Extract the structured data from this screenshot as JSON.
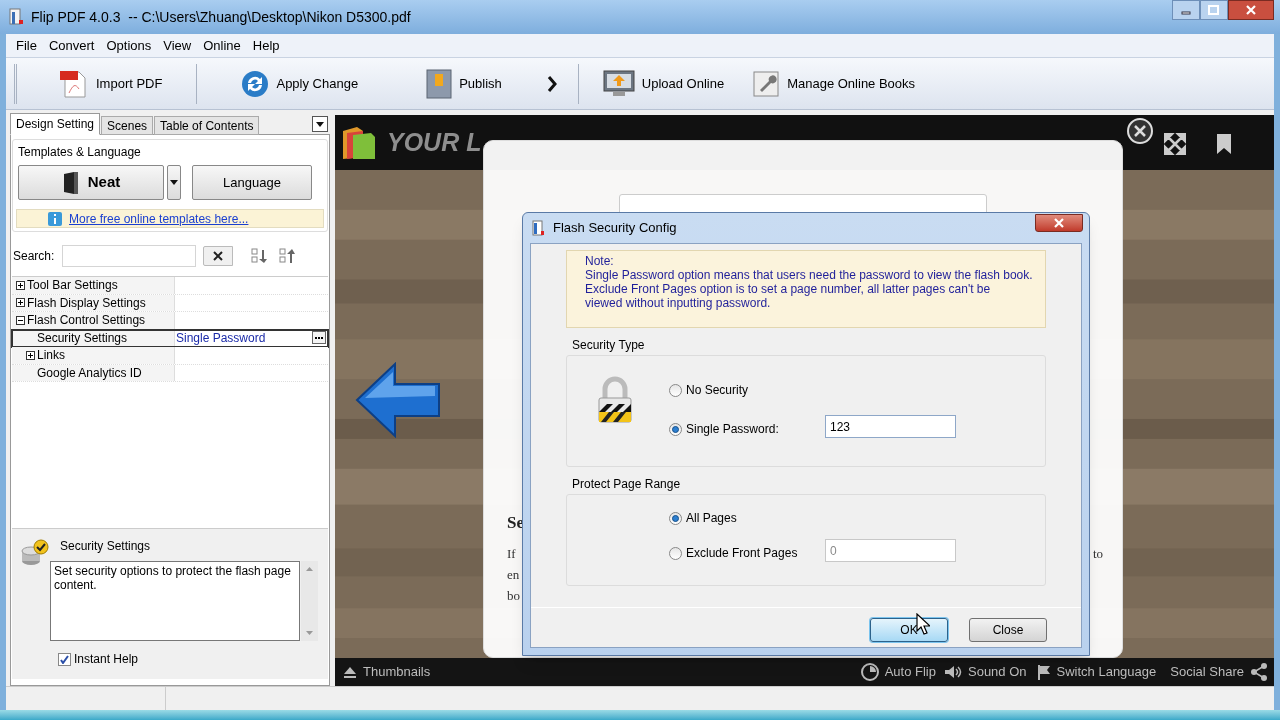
{
  "window": {
    "title": "Flip PDF 4.0.3  -- C:\\Users\\Zhuang\\Desktop\\Nikon D5300.pdf"
  },
  "menu": [
    "File",
    "Convert",
    "Options",
    "View",
    "Online",
    "Help"
  ],
  "toolbar": [
    {
      "kind": "button",
      "label": "Import PDF"
    },
    {
      "kind": "button",
      "label": "Apply Change"
    },
    {
      "kind": "button",
      "label": "Publish"
    },
    {
      "kind": "more"
    },
    {
      "kind": "button",
      "label": "Upload Online"
    },
    {
      "kind": "button",
      "label": "Manage Online Books"
    }
  ],
  "left_panel": {
    "tabs": [
      {
        "label": "Design Setting",
        "selected": true
      },
      {
        "label": "Scenes",
        "selected": false
      },
      {
        "label": "Table of Contents",
        "selected": false
      }
    ],
    "templates": {
      "title": "Templates & Language",
      "template": "Neat",
      "language_button": "Language",
      "link": "More free online templates here..."
    },
    "search": {
      "label": "Search:"
    },
    "properties": [
      {
        "kind": "group",
        "label": "Tool Bar Settings",
        "expanded": false,
        "selected": false
      },
      {
        "kind": "group",
        "label": "Flash Display Settings",
        "expanded": false,
        "selected": false
      },
      {
        "kind": "group",
        "label": "Flash Control Settings",
        "expanded": true,
        "selected": false,
        "children": [
          {
            "kind": "property",
            "label": "Security Settings",
            "value": "Single Password",
            "selected": true
          },
          {
            "kind": "group",
            "label": "Links",
            "expanded": false,
            "selected": false
          },
          {
            "kind": "property",
            "label": "Google Analytics ID",
            "selected": false
          }
        ]
      }
    ],
    "help": {
      "title": "Security Settings",
      "text": "Set security options to protect the flash page content.",
      "instant_help": {
        "label": "Instant Help",
        "checked": true
      }
    }
  },
  "preview": {
    "logo_text": "YOUR L",
    "page": {
      "heading": "Se",
      "text_lines": [
        "If",
        "en",
        "bo"
      ],
      "right_fragment": "to"
    },
    "bottom_bar": [
      "Thumbnails",
      "Auto Flip",
      "Sound On",
      "Switch Language",
      "Social Share"
    ]
  },
  "dialog": {
    "title": "Flash Security Config",
    "note": {
      "title": "Note:",
      "lines": [
        "Single Password option means that users need the password to view the flash book.",
        "Exclude Front Pages option is to set a page number, all latter pages can't be",
        "viewed without inputting password."
      ]
    },
    "security_type": {
      "title": "Security Type",
      "options": [
        {
          "label": "No Security",
          "selected": false
        },
        {
          "label": "Single Password:",
          "selected": true,
          "value": "123",
          "disabled": false
        }
      ]
    },
    "page_range": {
      "title": "Protect Page Range",
      "options": [
        {
          "label": "All Pages",
          "selected": true
        },
        {
          "label": "Exclude Front Pages",
          "selected": false,
          "value": "0",
          "disabled": true
        }
      ]
    },
    "buttons": [
      {
        "label": "OK",
        "default": true
      },
      {
        "label": "Close",
        "default": false
      }
    ]
  }
}
